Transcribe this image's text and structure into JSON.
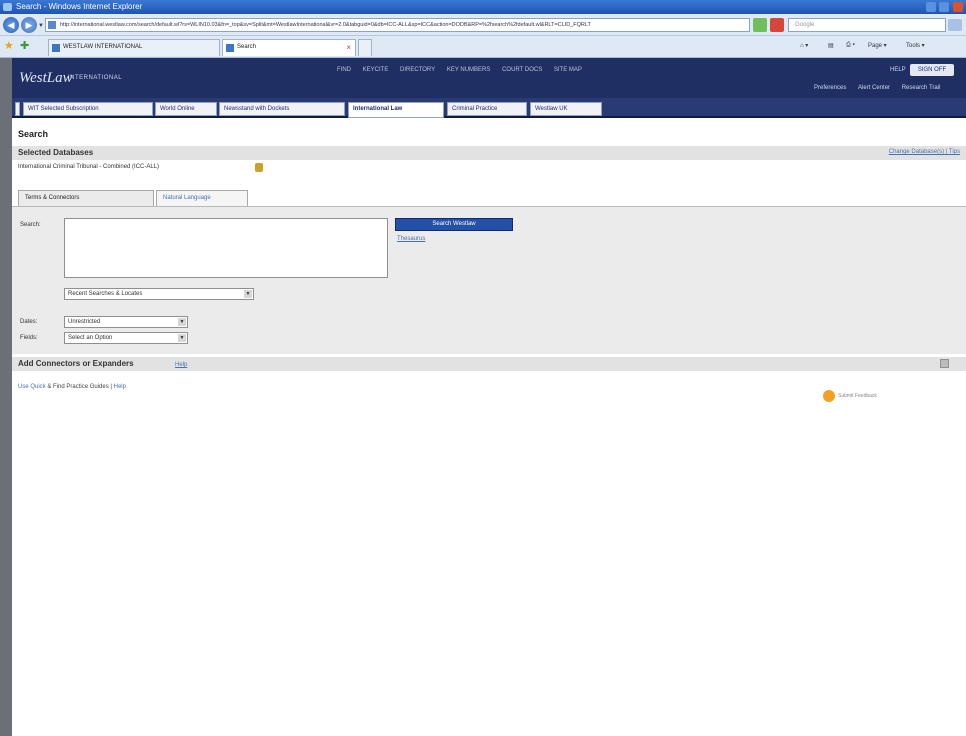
{
  "window": {
    "title": "Search - Windows Internet Explorer"
  },
  "browser": {
    "url": "http://international.westlaw.com/search/default.wl?rs=WLIN10.03&fn=_top&sv=Split&mt=WestlawInternational&vr=2.0&tabguid=0&db=ICC-ALL&sp=ICC&action=DODB&RP=%2fsearch%2fdefault.wl&RLT=CLID_FQRLT",
    "search_placeholder": "Google",
    "tabs": [
      {
        "label": "WESTLAW INTERNATIONAL"
      },
      {
        "label": "Search"
      }
    ],
    "tools": {
      "page": "Page ▾",
      "tools": "Tools ▾"
    }
  },
  "site": {
    "brand": "WestLaw",
    "brand_sub": "INTERNATIONAL",
    "top_nav": [
      "FIND",
      "KEYCITE",
      "DIRECTORY",
      "KEY NUMBERS",
      "COURT DOCS",
      "SITE MAP"
    ],
    "help": "HELP",
    "sign_off": "SIGN OFF",
    "util_links": [
      "Preferences",
      "Alert Center",
      "Research Trail"
    ],
    "tabs": [
      {
        "label": "WIT Selected Subscription"
      },
      {
        "label": "World Online"
      },
      {
        "label": "Newsstand with Dockets"
      },
      {
        "label": "International Law"
      },
      {
        "label": "Criminal Practice"
      },
      {
        "label": "Westlaw UK"
      }
    ]
  },
  "search": {
    "heading": "Search",
    "selected_db_title": "Selected Databases",
    "change_links": "Change Database(s) | Tips",
    "db_line": "International Criminal Tribunal - Combined (ICC-ALL)",
    "form_tabs": [
      "Terms & Connectors",
      "Natural Language"
    ],
    "search_label": "Search:",
    "search_button": "Search Westlaw",
    "thesaurus": "Thesaurus",
    "recent_searches": "Recent Searches & Locates",
    "dates_label": "Dates:",
    "dates_value": "Unrestricted",
    "fields_label": "Fields:",
    "fields_value": "Select an Option",
    "add_title": "Add Connectors or Expanders",
    "add_help": "Help",
    "footer_link": "Use Quick",
    "footer_text": "& Find Practice Guides",
    "footer_help": "Help",
    "feedback": "Submit Feedback"
  }
}
